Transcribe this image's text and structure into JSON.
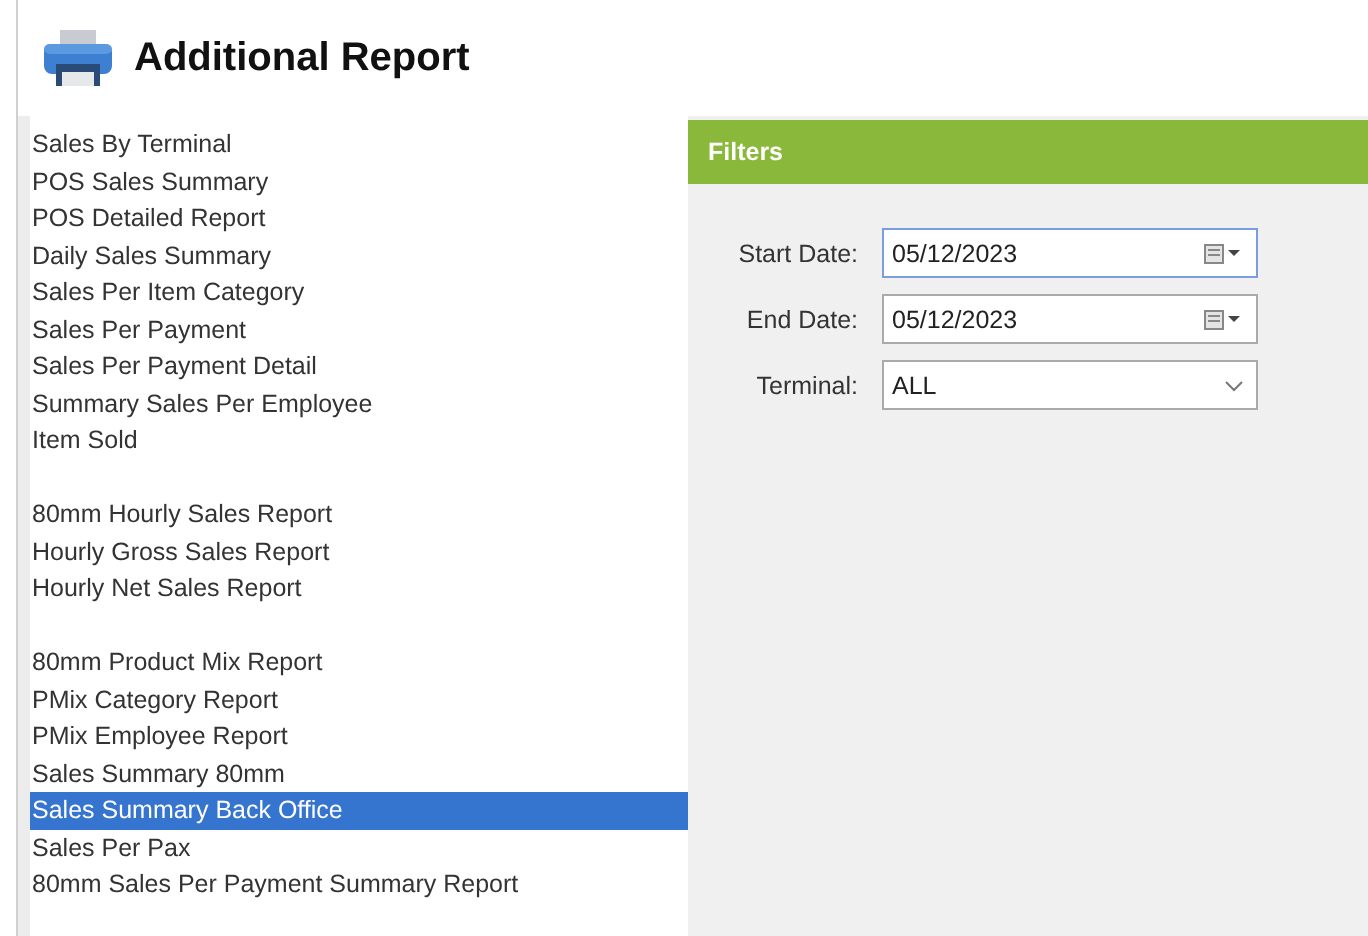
{
  "title": "Additional Report",
  "report_groups": [
    {
      "items": [
        {
          "label": "Sales By Terminal",
          "selected": false
        },
        {
          "label": "POS Sales Summary",
          "selected": false
        },
        {
          "label": "POS Detailed Report",
          "selected": false
        },
        {
          "label": "Daily Sales Summary",
          "selected": false
        },
        {
          "label": "Sales Per Item Category",
          "selected": false
        },
        {
          "label": "Sales Per Payment",
          "selected": false
        },
        {
          "label": "Sales Per Payment Detail",
          "selected": false
        },
        {
          "label": "Summary Sales Per Employee",
          "selected": false
        },
        {
          "label": "Item Sold",
          "selected": false
        }
      ]
    },
    {
      "items": [
        {
          "label": "80mm Hourly Sales Report",
          "selected": false
        },
        {
          "label": "Hourly Gross Sales Report",
          "selected": false
        },
        {
          "label": "Hourly Net Sales Report",
          "selected": false
        }
      ]
    },
    {
      "items": [
        {
          "label": "80mm Product Mix Report",
          "selected": false
        },
        {
          "label": "PMix Category Report",
          "selected": false
        },
        {
          "label": "PMix Employee Report",
          "selected": false
        },
        {
          "label": "Sales Summary 80mm",
          "selected": false
        },
        {
          "label": "Sales Summary Back Office",
          "selected": true
        },
        {
          "label": "Sales Per Pax",
          "selected": false
        },
        {
          "label": "80mm Sales Per Payment Summary Report",
          "selected": false
        }
      ]
    }
  ],
  "filters": {
    "title": "Filters",
    "fields": [
      {
        "kind": "date",
        "label": "Start Date:",
        "value": "05/12/2023",
        "focused": true
      },
      {
        "kind": "date",
        "label": "End Date:",
        "value": "05/12/2023",
        "focused": false
      },
      {
        "kind": "select",
        "label": "Terminal:",
        "value": "ALL",
        "focused": false
      }
    ]
  }
}
